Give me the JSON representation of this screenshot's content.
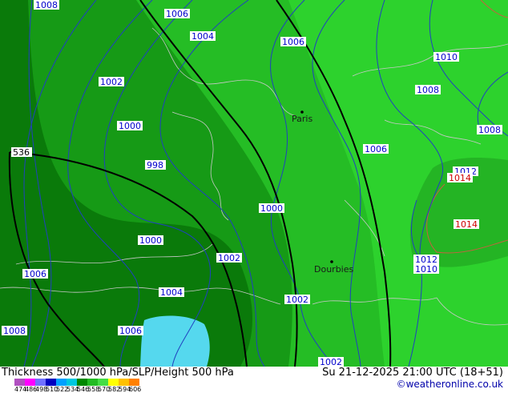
{
  "map": {
    "city_labels": [
      "Paris",
      "Dourbies"
    ],
    "isobar_labels": [
      "1008",
      "1006",
      "1004",
      "1006",
      "1010",
      "1002",
      "1008",
      "1000",
      "1008",
      "1006",
      "998",
      "1012",
      "1014",
      "1014",
      "1000",
      "1000",
      "1002",
      "1012",
      "1010",
      "1002",
      "1006",
      "1004",
      "1008",
      "1006",
      "1002"
    ],
    "height_label": "536",
    "colors": {
      "ocean": "#55b5d8",
      "thickness_dark": "#0a7a0a",
      "thickness_mid": "#169a16",
      "thickness_light": "#25bd25",
      "thickness_bright": "#2dd22d",
      "highland": "#3fbf3f",
      "isobar": "#2040c0",
      "height_contour": "#000000",
      "coastline": "#c8c8c8",
      "high_pressure": "#c86040",
      "label_high": "#d00000"
    }
  },
  "footer": {
    "title": "Thickness 500/1000 hPa/SLP/Height 500 hPa",
    "datetime": "Su 21-12-2025 21:00 UTC (18+51)",
    "credit": "©weatheronline.co.uk",
    "scale_values": [
      "474",
      "486",
      "498",
      "510",
      "522",
      "534",
      "546",
      "558",
      "570",
      "582",
      "594",
      "606"
    ],
    "scale_colors": [
      "#b050c0",
      "#ff00ff",
      "#7070ff",
      "#0000c0",
      "#00a0ff",
      "#00c8e0",
      "#008800",
      "#22bb22",
      "#44dd44",
      "#ffff00",
      "#ffc000",
      "#ff8000"
    ]
  }
}
